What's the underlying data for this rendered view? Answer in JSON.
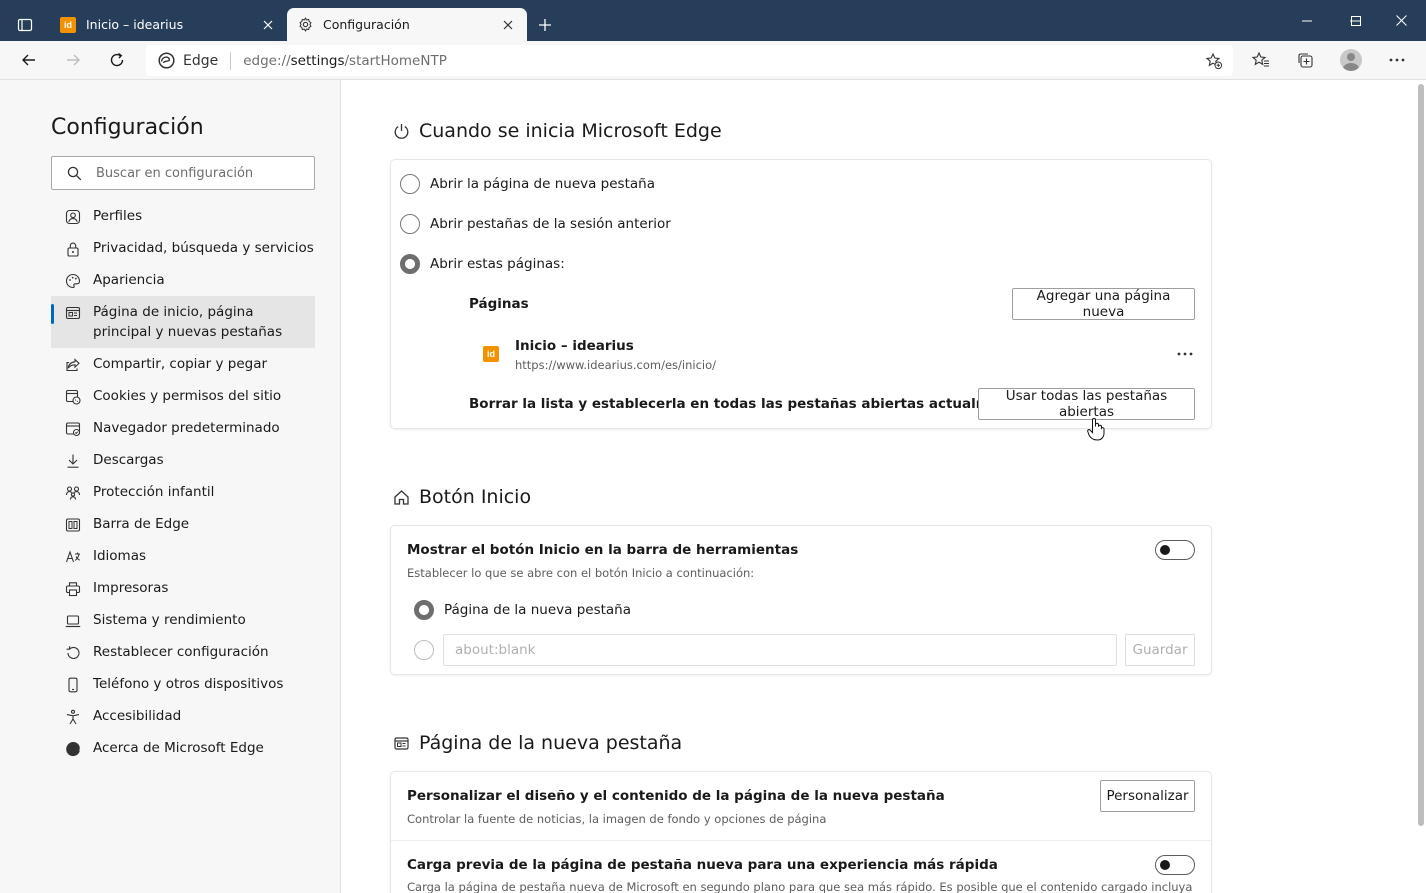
{
  "tabs": [
    {
      "title": "Inicio – idearius",
      "favicon": "idearius-favicon",
      "active": false
    },
    {
      "title": "Configuración",
      "favicon": "gear-icon",
      "active": true
    }
  ],
  "address": {
    "site_label": "Edge",
    "url_prefix": "edge://",
    "url_host": "settings",
    "url_path": "/startHomeNTP"
  },
  "sidebar": {
    "title": "Configuración",
    "search_placeholder": "Buscar en configuración",
    "items": [
      {
        "label": "Perfiles",
        "icon": "profile-icon"
      },
      {
        "label": "Privacidad, búsqueda y servicios",
        "icon": "lock-icon"
      },
      {
        "label": "Apariencia",
        "icon": "palette-icon"
      },
      {
        "label": "Página de inicio, página principal y nuevas pestañas",
        "icon": "home-tabs-icon",
        "selected": true
      },
      {
        "label": "Compartir, copiar y pegar",
        "icon": "share-icon"
      },
      {
        "label": "Cookies y permisos del sitio",
        "icon": "cookies-icon"
      },
      {
        "label": "Navegador predeterminado",
        "icon": "browser-icon"
      },
      {
        "label": "Descargas",
        "icon": "download-icon"
      },
      {
        "label": "Protección infantil",
        "icon": "family-icon"
      },
      {
        "label": "Barra de Edge",
        "icon": "edge-bar-icon"
      },
      {
        "label": "Idiomas",
        "icon": "language-icon"
      },
      {
        "label": "Impresoras",
        "icon": "printer-icon"
      },
      {
        "label": "Sistema y rendimiento",
        "icon": "laptop-icon"
      },
      {
        "label": "Restablecer configuración",
        "icon": "reset-icon"
      },
      {
        "label": "Teléfono y otros dispositivos",
        "icon": "phone-icon"
      },
      {
        "label": "Accesibilidad",
        "icon": "accessibility-icon"
      },
      {
        "label": "Acerca de Microsoft Edge",
        "icon": "edge-logo-icon"
      }
    ]
  },
  "startup": {
    "title": "Cuando se inicia Microsoft Edge",
    "options": [
      {
        "label": "Abrir la página de nueva pestaña",
        "checked": false
      },
      {
        "label": "Abrir pestañas de la sesión anterior",
        "checked": false
      },
      {
        "label": "Abrir estas páginas:",
        "checked": true
      }
    ],
    "pages_label": "Páginas",
    "add_page_button": "Agregar una página nueva",
    "page": {
      "title": "Inicio – idearius",
      "url": "https://www.idearius.com/es/inicio/",
      "favicon_text": "id"
    },
    "more_options": "⋯",
    "clear_label": "Borrar la lista y establecerla en todas las pestañas abiertas actualmente",
    "use_all_button": "Usar todas las pestañas abiertas"
  },
  "home_button": {
    "title": "Botón Inicio",
    "show_label": "Mostrar el botón Inicio en la barra de herramientas",
    "show_sub": "Establecer lo que se abre con el botón Inicio a continuación:",
    "toggle_on": false,
    "option_ntp": "Página de la nueva pestaña",
    "url_placeholder": "about:blank",
    "save_button": "Guardar"
  },
  "new_tab": {
    "title": "Página de la nueva pestaña",
    "customize_label": "Personalizar el diseño y el contenido de la página de la nueva pestaña",
    "customize_sub": "Controlar la fuente de noticias, la imagen de fondo y opciones de página",
    "customize_button": "Personalizar",
    "preload_label": "Carga previa de la página de pestaña nueva para una experiencia más rápida",
    "preload_sub": "Carga la página de pestaña nueva de Microsoft en segundo plano para que sea más rápido. Es posible que el contenido cargado incluya",
    "preload_on": false
  },
  "colors": {
    "accent": "#0067c0",
    "titlebar": "#263e5a",
    "idearius_orange": "#f39200"
  }
}
